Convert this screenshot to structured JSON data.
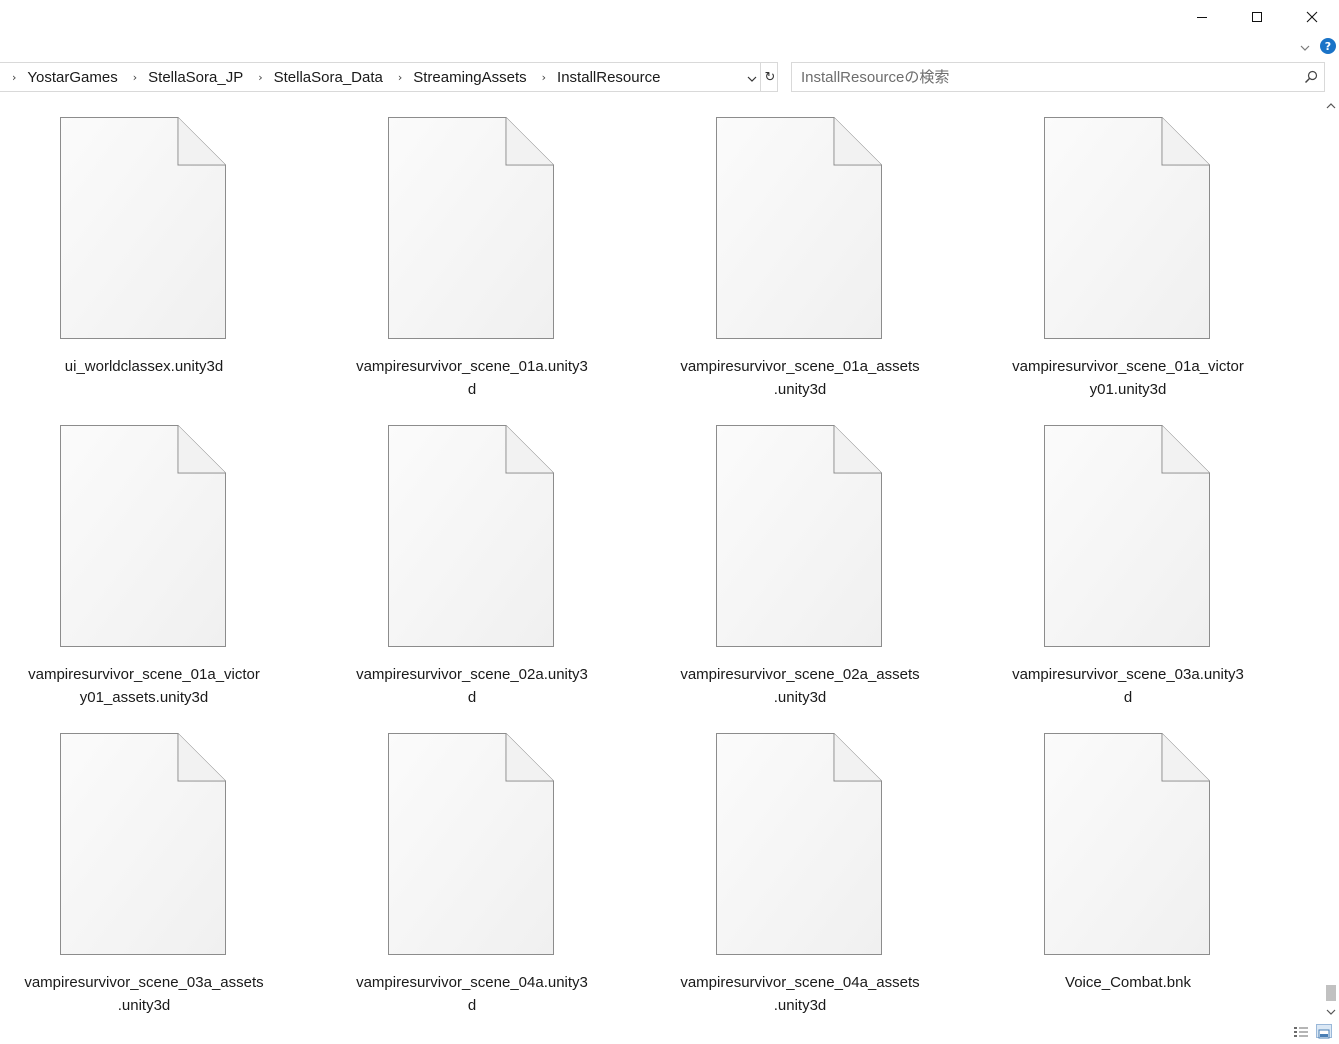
{
  "window": {
    "controls": {
      "minimize": "minimize-icon",
      "maximize": "maximize-icon",
      "close": "close-icon"
    },
    "help_label": "?"
  },
  "address_bar": {
    "breadcrumbs": [
      "YostarGames",
      "StellaSora_JP",
      "StellaSora_Data",
      "StreamingAssets",
      "InstallResource"
    ],
    "refresh_glyph": "↻"
  },
  "search": {
    "placeholder": "InstallResourceの検索",
    "value": ""
  },
  "files": [
    {
      "lines": [
        "ui_worldclassex.unity3d"
      ]
    },
    {
      "lines": [
        "vampiresurvivor_scene_01a.unity3",
        "d"
      ]
    },
    {
      "lines": [
        "vampiresurvivor_scene_01a_assets",
        ".unity3d"
      ]
    },
    {
      "lines": [
        "vampiresurvivor_scene_01a_victor",
        "y01.unity3d"
      ]
    },
    {
      "lines": [
        "vampiresurvivor_scene_01a_victor",
        "y01_assets.unity3d"
      ]
    },
    {
      "lines": [
        "vampiresurvivor_scene_02a.unity3",
        "d"
      ]
    },
    {
      "lines": [
        "vampiresurvivor_scene_02a_assets",
        ".unity3d"
      ]
    },
    {
      "lines": [
        "vampiresurvivor_scene_03a.unity3",
        "d"
      ]
    },
    {
      "lines": [
        "vampiresurvivor_scene_03a_assets",
        ".unity3d"
      ]
    },
    {
      "lines": [
        "vampiresurvivor_scene_04a.unity3",
        "d"
      ]
    },
    {
      "lines": [
        "vampiresurvivor_scene_04a_assets",
        ".unity3d"
      ]
    },
    {
      "lines": [
        "Voice_Combat.bnk"
      ]
    }
  ],
  "scrollbar": {
    "position": 0.98
  },
  "colors": {
    "accent": "#1a73c7",
    "icon_border": "#8c8c8c",
    "icon_fill": "#f7f7f7"
  }
}
